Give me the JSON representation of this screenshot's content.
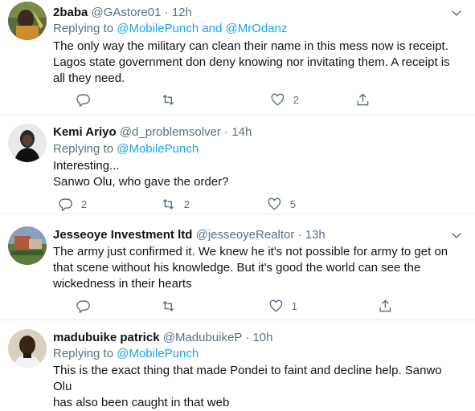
{
  "tweets": [
    {
      "name": "2baba",
      "handle": "@GAstore01",
      "time": "12h",
      "replying_prefix": "Replying to",
      "mentions": [
        "@MobilePunch",
        "@MrOdanz"
      ],
      "mentions_joiner": "and",
      "lines": [
        "The only way the military can clean their name in this mess now is receipt.",
        "Lagos state government don deny knowing nor invitating them. A receipt is",
        "all they need."
      ],
      "reply_count": "",
      "retweet_count": "",
      "like_count": "2"
    },
    {
      "name": "Kemi Ariyo",
      "handle": "@d_problemsolver",
      "time": "14h",
      "replying_prefix": "Replying to",
      "mentions": [
        "@MobilePunch"
      ],
      "lines": [
        "Interesting...",
        "Sanwo Olu, who gave the order?"
      ],
      "reply_count": "2",
      "retweet_count": "2",
      "like_count": "5"
    },
    {
      "name": "Jesseoye Investment ltd",
      "handle": "@jesseoyeRealtor",
      "time": "13h",
      "lines": [
        "The army just confirmed it. We knew he it's not possible for army to get on",
        "that scene without his knowledge. But it's good the world can see the",
        "wickedness in their hearts"
      ],
      "reply_count": "",
      "retweet_count": "",
      "like_count": "1"
    },
    {
      "name": "madubuike patrick",
      "handle": "@MadubuikeP",
      "time": "10h",
      "replying_prefix": "Replying to",
      "mentions": [
        "@MobilePunch"
      ],
      "lines": [
        "This is the exact thing that made Pondei to faint and decline help. Sanwo Olu",
        "has also been caught in that web"
      ]
    }
  ],
  "separator": "·",
  "icons": [
    "more-icon",
    "reply-icon",
    "retweet-icon",
    "like-icon",
    "share-icon"
  ],
  "colors": {
    "link": "#1da1f2",
    "muted": "#5b7083",
    "text": "#0f1419",
    "divider": "#e6ecf0"
  }
}
